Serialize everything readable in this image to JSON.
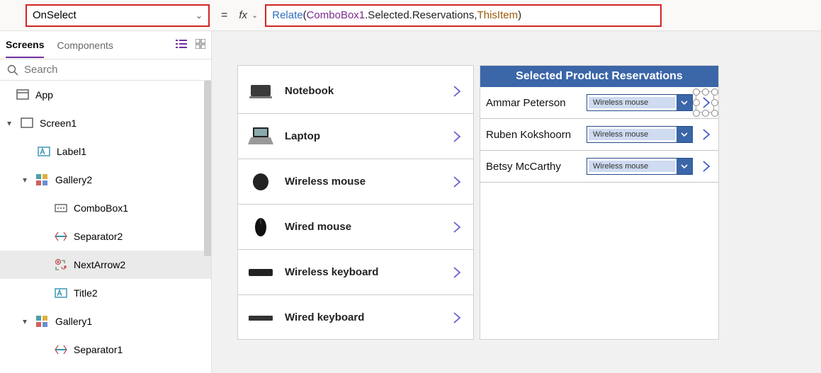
{
  "topbar": {
    "property": "OnSelect",
    "equals": "=",
    "fx_label": "fx",
    "formula_tokens": [
      {
        "t": "fn",
        "v": "Relate"
      },
      {
        "t": "punc",
        "v": "( "
      },
      {
        "t": "id",
        "v": "ComboBox1"
      },
      {
        "t": "prop",
        "v": ".Selected.Reservations"
      },
      {
        "t": "punc",
        "v": ", "
      },
      {
        "t": "this",
        "v": "ThisItem"
      },
      {
        "t": "punc",
        "v": " )"
      }
    ]
  },
  "leftpanel": {
    "tabs": {
      "screens": "Screens",
      "components": "Components"
    },
    "search_placeholder": "Search",
    "tree": [
      {
        "depth": 0,
        "icon": "app",
        "label": "App",
        "caret": ""
      },
      {
        "depth": 0,
        "icon": "screen",
        "label": "Screen1",
        "caret": "▾"
      },
      {
        "depth": 1,
        "icon": "label",
        "label": "Label1",
        "caret": ""
      },
      {
        "depth": 1,
        "icon": "gallery",
        "label": "Gallery2",
        "caret": "▾"
      },
      {
        "depth": 2,
        "icon": "combobox",
        "label": "ComboBox1",
        "caret": ""
      },
      {
        "depth": 2,
        "icon": "separator",
        "label": "Separator2",
        "caret": ""
      },
      {
        "depth": 2,
        "icon": "nextarrow",
        "label": "NextArrow2",
        "caret": "",
        "selected": true
      },
      {
        "depth": 2,
        "icon": "label",
        "label": "Title2",
        "caret": ""
      },
      {
        "depth": 1,
        "icon": "gallery",
        "label": "Gallery1",
        "caret": "▾"
      },
      {
        "depth": 2,
        "icon": "separator",
        "label": "Separator1",
        "caret": ""
      }
    ]
  },
  "canvas": {
    "products": [
      {
        "name": "Notebook",
        "thumb": "laptop-closed"
      },
      {
        "name": "Laptop",
        "thumb": "laptop-open"
      },
      {
        "name": "Wireless mouse",
        "thumb": "mouse-bulky"
      },
      {
        "name": "Wired mouse",
        "thumb": "mouse-slim"
      },
      {
        "name": "Wireless keyboard",
        "thumb": "keyboard-dark"
      },
      {
        "name": "Wired keyboard",
        "thumb": "keyboard-slim"
      }
    ],
    "reservations_header": "Selected Product Reservations",
    "reservations": [
      {
        "name": "Ammar Peterson",
        "combo": "Wireless mouse",
        "selected": true
      },
      {
        "name": "Ruben Kokshoorn",
        "combo": "Wireless mouse"
      },
      {
        "name": "Betsy McCarthy",
        "combo": "Wireless mouse"
      }
    ]
  }
}
